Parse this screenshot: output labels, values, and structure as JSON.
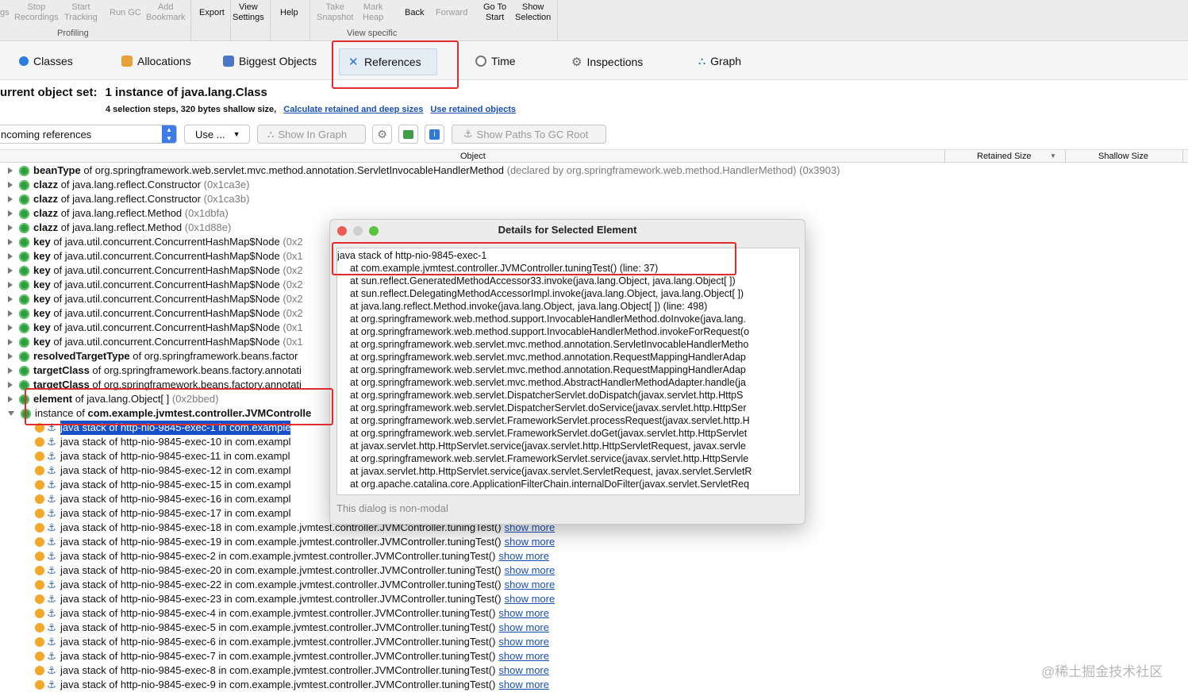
{
  "toolbar": {
    "profiling": [
      {
        "label": "gs",
        "enabled": false
      },
      {
        "label": "Stop\nRecordings",
        "enabled": false
      },
      {
        "label": "Start\nTracking",
        "enabled": false
      },
      {
        "label": "Run GC",
        "enabled": false
      },
      {
        "label": "Add\nBookmark",
        "enabled": false
      }
    ],
    "profiling_caption": "Profiling",
    "export": "Export",
    "view_settings": "View\nSettings",
    "help": "Help",
    "view_specific": [
      {
        "label": "Take\nSnapshot",
        "enabled": false
      },
      {
        "label": "Mark\nHeap",
        "enabled": false
      },
      {
        "label": "Back",
        "enabled": true
      },
      {
        "label": "Forward",
        "enabled": false
      },
      {
        "label": "Go To\nStart",
        "enabled": true
      },
      {
        "label": "Show\nSelection",
        "enabled": true
      }
    ],
    "view_specific_caption": "View specific"
  },
  "tabs": [
    {
      "label": "Classes",
      "icon": "classes-icon",
      "color": "#2a7de1"
    },
    {
      "label": "Allocations",
      "icon": "allocations-icon",
      "color": "#e8a13a"
    },
    {
      "label": "Biggest Objects",
      "icon": "biggest-objects-icon",
      "color": "#4a78c8"
    },
    {
      "label": "References",
      "icon": "references-icon",
      "color": "#2a6fd6"
    },
    {
      "label": "Time",
      "icon": "time-icon",
      "color": "#777777"
    },
    {
      "label": "Inspections",
      "icon": "inspections-icon",
      "color": "#777777"
    },
    {
      "label": "Graph",
      "icon": "graph-icon",
      "color": "#2a6fd6"
    }
  ],
  "object_set": {
    "label": "urrent object set:",
    "value": "1 instance of java.lang.Class",
    "details": "4 selection steps, 320 bytes shallow size,",
    "link1": "Calculate retained and deep sizes",
    "link2": "Use retained objects"
  },
  "controls": {
    "reference_type": "ncoming references",
    "use": "Use ...",
    "show_in_graph": "Show In Graph",
    "show_paths": "Show Paths To GC Root"
  },
  "columns": {
    "object": "Object",
    "retained": "Retained Size",
    "shallow": "Shallow Size"
  },
  "rows": [
    {
      "b": "beanType",
      "t": " of org.springframework.web.servlet.mvc.method.annotation.ServletInvocableHandlerMethod ",
      "g": "(declared by org.springframework.web.method.HandlerMethod) (0x3903)"
    },
    {
      "b": "clazz",
      "t": " of java.lang.reflect.Constructor ",
      "g": "(0x1ca3e)"
    },
    {
      "b": "clazz",
      "t": " of java.lang.reflect.Constructor ",
      "g": "(0x1ca3b)"
    },
    {
      "b": "clazz",
      "t": " of java.lang.reflect.Method ",
      "g": "(0x1dbfa)"
    },
    {
      "b": "clazz",
      "t": " of java.lang.reflect.Method ",
      "g": "(0x1d88e)"
    },
    {
      "b": "key",
      "t": " of java.util.concurrent.ConcurrentHashMap$Node ",
      "g": "(0x2"
    },
    {
      "b": "key",
      "t": " of java.util.concurrent.ConcurrentHashMap$Node ",
      "g": "(0x1"
    },
    {
      "b": "key",
      "t": " of java.util.concurrent.ConcurrentHashMap$Node ",
      "g": "(0x2"
    },
    {
      "b": "key",
      "t": " of java.util.concurrent.ConcurrentHashMap$Node ",
      "g": "(0x2"
    },
    {
      "b": "key",
      "t": " of java.util.concurrent.ConcurrentHashMap$Node ",
      "g": "(0x2"
    },
    {
      "b": "key",
      "t": " of java.util.concurrent.ConcurrentHashMap$Node ",
      "g": "(0x2"
    },
    {
      "b": "key",
      "t": " of java.util.concurrent.ConcurrentHashMap$Node ",
      "g": "(0x1"
    },
    {
      "b": "key",
      "t": " of java.util.concurrent.ConcurrentHashMap$Node ",
      "g": "(0x1"
    },
    {
      "b": "resolvedTargetType",
      "t": " of org.springframework.beans.factor",
      "g": ""
    },
    {
      "b": "targetClass",
      "t": " of org.springframework.beans.factory.annotati",
      "g": ""
    },
    {
      "b": "targetClass",
      "t": " of org.springframework.beans.factory.annotati",
      "g": ""
    },
    {
      "b": "element",
      "t": " of java.lang.Object[ ] ",
      "g": "(0x2bbed)"
    },
    {
      "b": "",
      "t": "instance of ",
      "b2": "com.example.jvmtest.controller.JVMControlle",
      "g": ""
    }
  ],
  "stack_rows": [
    {
      "text": "java stack of http-nio-9845-exec-1 in com.example",
      "more": ""
    },
    {
      "text": "java stack of http-nio-9845-exec-10 in com.exampl",
      "more": ""
    },
    {
      "text": "java stack of http-nio-9845-exec-11 in com.exampl",
      "more": ""
    },
    {
      "text": "java stack of http-nio-9845-exec-12 in com.exampl",
      "more": ""
    },
    {
      "text": "java stack of http-nio-9845-exec-15 in com.exampl",
      "more": ""
    },
    {
      "text": "java stack of http-nio-9845-exec-16 in com.exampl",
      "more": ""
    },
    {
      "text": "java stack of http-nio-9845-exec-17 in com.exampl",
      "more": ""
    },
    {
      "text": "java stack of http-nio-9845-exec-18 in com.example.jvmtest.controller.JVMController.tuningTest()",
      "more": "show more"
    },
    {
      "text": "java stack of http-nio-9845-exec-19 in com.example.jvmtest.controller.JVMController.tuningTest()",
      "more": "show more"
    },
    {
      "text": "java stack of http-nio-9845-exec-2 in com.example.jvmtest.controller.JVMController.tuningTest()",
      "more": "show more"
    },
    {
      "text": "java stack of http-nio-9845-exec-20 in com.example.jvmtest.controller.JVMController.tuningTest()",
      "more": "show more"
    },
    {
      "text": "java stack of http-nio-9845-exec-22 in com.example.jvmtest.controller.JVMController.tuningTest()",
      "more": "show more"
    },
    {
      "text": "java stack of http-nio-9845-exec-23 in com.example.jvmtest.controller.JVMController.tuningTest()",
      "more": "show more"
    },
    {
      "text": "java stack of http-nio-9845-exec-4 in com.example.jvmtest.controller.JVMController.tuningTest()",
      "more": "show more"
    },
    {
      "text": "java stack of http-nio-9845-exec-5 in com.example.jvmtest.controller.JVMController.tuningTest()",
      "more": "show more"
    },
    {
      "text": "java stack of http-nio-9845-exec-6 in com.example.jvmtest.controller.JVMController.tuningTest()",
      "more": "show more"
    },
    {
      "text": "java stack of http-nio-9845-exec-7 in com.example.jvmtest.controller.JVMController.tuningTest()",
      "more": "show more"
    },
    {
      "text": "java stack of http-nio-9845-exec-8 in com.example.jvmtest.controller.JVMController.tuningTest()",
      "more": "show more"
    },
    {
      "text": "java stack of http-nio-9845-exec-9 in com.example.jvmtest.controller.JVMController.tuningTest()",
      "more": "show more"
    }
  ],
  "dialog": {
    "title": "Details for Selected Element",
    "header": "java stack of http-nio-9845-exec-1",
    "frames": [
      "at com.example.jvmtest.controller.JVMController.tuningTest() (line: 37)",
      "at sun.reflect.GeneratedMethodAccessor33.invoke(java.lang.Object, java.lang.Object[ ])",
      "at sun.reflect.DelegatingMethodAccessorImpl.invoke(java.lang.Object, java.lang.Object[ ])",
      "at java.lang.reflect.Method.invoke(java.lang.Object, java.lang.Object[ ]) (line: 498)",
      "at org.springframework.web.method.support.InvocableHandlerMethod.doInvoke(java.lang.",
      "at org.springframework.web.method.support.InvocableHandlerMethod.invokeForRequest(o",
      "at org.springframework.web.servlet.mvc.method.annotation.ServletInvocableHandlerMetho",
      "at org.springframework.web.servlet.mvc.method.annotation.RequestMappingHandlerAdap",
      "at org.springframework.web.servlet.mvc.method.annotation.RequestMappingHandlerAdap",
      "at org.springframework.web.servlet.mvc.method.AbstractHandlerMethodAdapter.handle(ja",
      "at org.springframework.web.servlet.DispatcherServlet.doDispatch(javax.servlet.http.HttpS",
      "at org.springframework.web.servlet.DispatcherServlet.doService(javax.servlet.http.HttpSer",
      "at org.springframework.web.servlet.FrameworkServlet.processRequest(javax.servlet.http.H",
      "at org.springframework.web.servlet.FrameworkServlet.doGet(javax.servlet.http.HttpServlet",
      "at javax.servlet.http.HttpServlet.service(javax.servlet.http.HttpServletRequest, javax.servle",
      "at org.springframework.web.servlet.FrameworkServlet.service(javax.servlet.http.HttpServle",
      "at javax.servlet.http.HttpServlet.service(javax.servlet.ServletRequest, javax.servlet.ServletR",
      "at org.apache.catalina.core.ApplicationFilterChain.internalDoFilter(javax.servlet.ServletReq"
    ],
    "footer": "This dialog is non-modal"
  },
  "watermark": "@稀土掘金技术社区",
  "colors": {
    "accent": "#1750c8",
    "link": "#1a4fb5",
    "highlight": "#e12c2c",
    "green_icon": "#2f9e3f",
    "orange_icon": "#f1a82b"
  }
}
